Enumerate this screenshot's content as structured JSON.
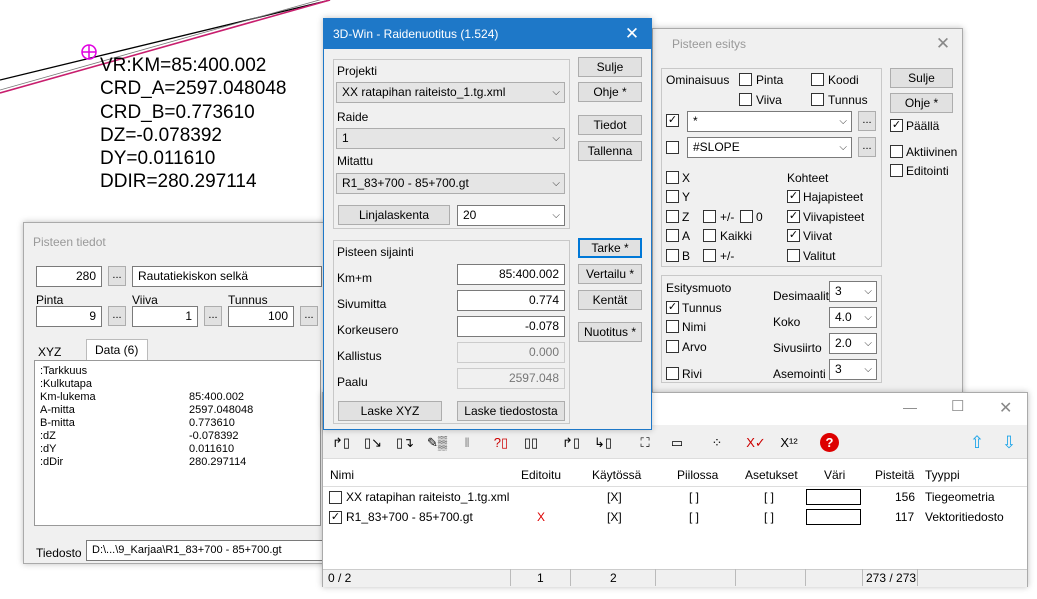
{
  "overlay": {
    "lines": [
      "VR:KM=85:400.002",
      "CRD_A=2597.048048",
      "CRD_B=0.773610",
      "DZ=-0.078392",
      "DY=0.011610",
      "DDIR=280.297114"
    ],
    "colors": {
      "line_black": "#000000",
      "line_magenta": "#c81e6e",
      "marker": "#e000e0"
    }
  },
  "pisteen_tiedot": {
    "title": "Pisteen tiedot",
    "code": "280",
    "code_desc": "Rautatiekiskon selkä",
    "pinta_label": "Pinta",
    "pinta": "9",
    "viiva_label": "Viiva",
    "viiva": "1",
    "tunnus_label": "Tunnus",
    "tunnus": "100",
    "tabs": [
      "XYZ",
      "Data (6)"
    ],
    "data_rows": [
      {
        "k": ":Tarkkuus",
        "v": ""
      },
      {
        "k": ":Kulkutapa",
        "v": ""
      },
      {
        "k": "Km-lukema",
        "v": "85:400.002"
      },
      {
        "k": "A-mitta",
        "v": "2597.048048"
      },
      {
        "k": "B-mitta",
        "v": "0.773610"
      },
      {
        "k": ":dZ",
        "v": "-0.078392"
      },
      {
        "k": ":dY",
        "v": "0.011610"
      },
      {
        "k": ":dDir",
        "v": "280.297114"
      }
    ],
    "tiedosto_label": "Tiedosto",
    "tiedosto": "D:\\...\\9_Karjaa\\R1_83+700 - 85+700.gt"
  },
  "raidenuotitus": {
    "title": "3D-Win - Raidenuotitus  (1.524)",
    "projekti_label": "Projekti",
    "projekti": "XX ratapihan raiteisto_1.tg.xml",
    "raide_label": "Raide",
    "raide": "1",
    "mitattu_label": "Mitattu",
    "mitattu": "R1_83+700 - 85+700.gt",
    "linjalaskenta": "Linjalaskenta",
    "linjalaskenta_value": "20",
    "sijainti_label": "Pisteen sijainti",
    "km_label": "Km+m",
    "km": "85:400.002",
    "sivumitta_label": "Sivumitta",
    "sivumitta": "0.774",
    "korkeusero_label": "Korkeusero",
    "korkeusero": "-0.078",
    "kallistus_label": "Kallistus",
    "kallistus": "0.000",
    "paalu_label": "Paalu",
    "paalu": "2597.048",
    "laske_xyz": "Laske XYZ",
    "laske_tiedostosta": "Laske tiedostosta",
    "buttons": {
      "sulje": "Sulje",
      "ohje": "Ohje *",
      "tiedot": "Tiedot",
      "tallenna": "Tallenna",
      "tarke": "Tarke *",
      "vertailu": "Vertailu *",
      "kentat": "Kentät",
      "nuotitus": "Nuotitus *"
    }
  },
  "pisteen_esitys": {
    "title": "Pisteen esitys",
    "ominaisuus_label": "Ominaisuus",
    "pinta": "Pinta",
    "koodi": "Koodi",
    "viiva": "Viiva",
    "tunnus": "Tunnus",
    "filter1": "*",
    "filter2": "#SLOPE",
    "x": "X",
    "y": "Y",
    "z": "Z",
    "a": "A",
    "b": "B",
    "pm": "+/-",
    "zero": "0",
    "kaikki": "Kaikki",
    "pm2": "+/-",
    "kohteet_label": "Kohteet",
    "hajapisteet": "Hajapisteet",
    "viivapisteet": "Viivapisteet",
    "viivat": "Viivat",
    "valitut": "Valitut",
    "esitysmuoto_label": "Esitysmuoto",
    "e_tunnus": "Tunnus",
    "e_nimi": "Nimi",
    "e_arvo": "Arvo",
    "e_rivi": "Rivi",
    "desimaalit_label": "Desimaalit",
    "desimaalit": "3",
    "koko_label": "Koko",
    "koko": "4.0",
    "sivusiirto_label": "Sivusiirto",
    "sivusiirto": "2.0",
    "asemointi_label": "Asemointi",
    "asemointi": "3",
    "sulje": "Sulje",
    "ohje": "Ohje *",
    "paalla": "Päällä",
    "aktiivinen": "Aktiivinen",
    "editointi": "Editointi"
  },
  "file_manager": {
    "columns": [
      "Nimi",
      "Editoitu",
      "Käytössä",
      "Piilossa",
      "Asetukset",
      "Väri",
      "Pisteitä",
      "Tyyppi"
    ],
    "rows": [
      {
        "checked": false,
        "name": "XX ratapihan raiteisto_1.tg.xml",
        "editoitu": "",
        "kaytossa": "[X]",
        "piilossa": "[ ]",
        "asetukset": "[ ]",
        "pisteita": "156",
        "tyyppi": "Tiegeometria"
      },
      {
        "checked": true,
        "name": "R1_83+700 - 85+700.gt",
        "editoitu": "X",
        "kaytossa": "[X]",
        "piilossa": "[ ]",
        "asetukset": "[ ]",
        "pisteita": "117",
        "tyyppi": "Vektoritiedosto"
      }
    ],
    "status": [
      "0 / 2",
      "1",
      "2",
      "",
      "",
      "",
      "273 / 273",
      ""
    ]
  }
}
